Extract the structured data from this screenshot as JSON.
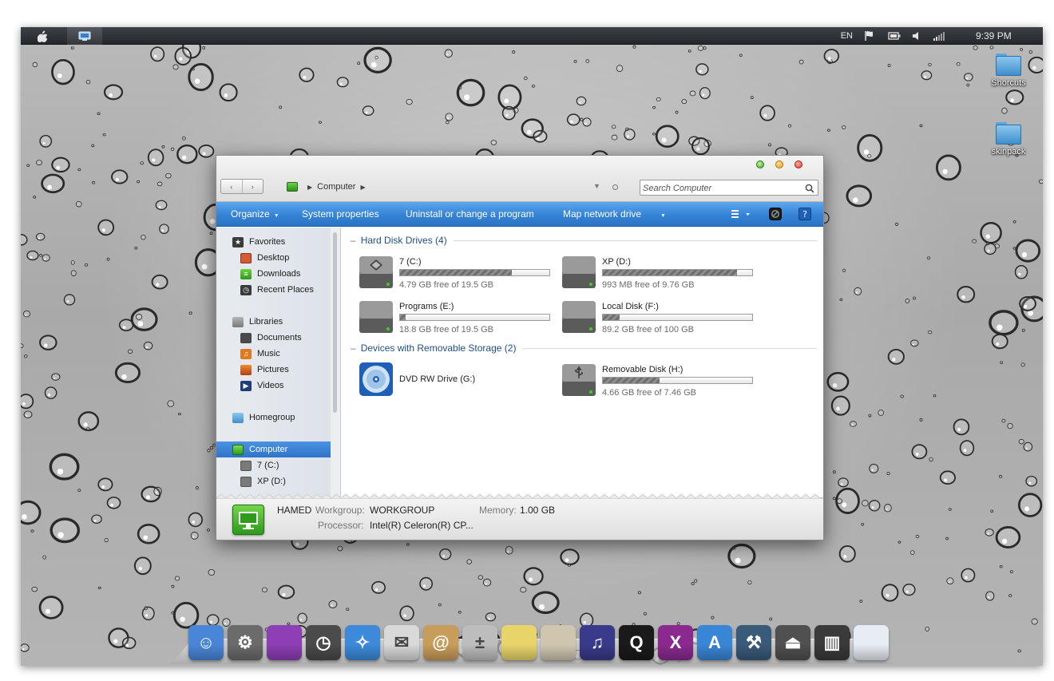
{
  "menubar": {
    "apple_icon": "apple-logo-icon",
    "computer_icon": "computer-menu-icon",
    "language": "EN",
    "time": "9:39 PM",
    "tray_icons": [
      "flag-icon",
      "battery-icon",
      "volume-icon",
      "signal-icon"
    ]
  },
  "desktop_icons": [
    {
      "label": "Shorcuts",
      "icon": "folder-icon"
    },
    {
      "label": "skinpack",
      "icon": "folder-icon"
    }
  ],
  "window": {
    "nav": {
      "back": "‹",
      "forward": "›"
    },
    "breadcrumb": [
      "Computer"
    ],
    "search": {
      "placeholder": "Search Computer"
    },
    "toolbar": [
      "Organize",
      "System properties",
      "Uninstall or change a program",
      "Map network drive"
    ],
    "nav_pane": {
      "favorites": {
        "label": "Favorites",
        "items": [
          "Desktop",
          "Downloads",
          "Recent Places"
        ]
      },
      "libraries": {
        "label": "Libraries",
        "items": [
          "Documents",
          "Music",
          "Pictures",
          "Videos"
        ]
      },
      "homegroup": "Homegroup",
      "computer": {
        "label": "Computer",
        "items": [
          "7 (C:)",
          "XP (D:)"
        ]
      }
    },
    "groups": {
      "hdd": {
        "label": "Hard Disk Drives (4)",
        "drives": [
          {
            "name": "7 (C:)",
            "free": "4.79 GB free of 19.5 GB",
            "used_fraction": 0.75
          },
          {
            "name": "XP (D:)",
            "free": "993 MB free of 9.76 GB",
            "used_fraction": 0.9
          },
          {
            "name": "Programs (E:)",
            "free": "18.8 GB free of 19.5 GB",
            "used_fraction": 0.04
          },
          {
            "name": "Local Disk (F:)",
            "free": "89.2 GB free of 100 GB",
            "used_fraction": 0.11
          }
        ]
      },
      "removable": {
        "label": "Devices with Removable Storage (2)",
        "drives": [
          {
            "name": "DVD RW Drive (G:)"
          },
          {
            "name": "Removable Disk (H:)",
            "free": "4.66 GB free of 7.46 GB",
            "used_fraction": 0.38
          }
        ]
      }
    },
    "details": {
      "name": "HAMED",
      "workgroup_label": "Workgroup:",
      "workgroup": "WORKGROUP",
      "memory_label": "Memory:",
      "memory": "1.00 GB",
      "processor_label": "Processor:",
      "processor": "Intel(R) Celeron(R) CP..."
    }
  },
  "dock": [
    {
      "name": "finder",
      "color": "#4a86d8"
    },
    {
      "name": "system-preferences",
      "color": "#6b6b6b"
    },
    {
      "name": "photo-booth",
      "color": "#8e3fb5"
    },
    {
      "name": "dashboard",
      "color": "#4b4b4b"
    },
    {
      "name": "safari",
      "color": "#3c8ad9"
    },
    {
      "name": "mail",
      "color": "#d9d9d9"
    },
    {
      "name": "address-book",
      "color": "#c89c5a"
    },
    {
      "name": "calculator",
      "color": "#bdbdbd"
    },
    {
      "name": "stickies",
      "color": "#e9d46a"
    },
    {
      "name": "textedit",
      "color": "#d0c6b0"
    },
    {
      "name": "itunes",
      "color": "#3a3a8a"
    },
    {
      "name": "quicktime",
      "color": "#1a1a1a"
    },
    {
      "name": "x-app",
      "color": "#8a2a8f"
    },
    {
      "name": "app-store",
      "color": "#3a86d6"
    },
    {
      "name": "xcode-tools",
      "color": "#3a5a7a"
    },
    {
      "name": "eject",
      "color": "#505050"
    },
    {
      "name": "trash",
      "color": "#3a3a3a"
    },
    {
      "name": "explorer-window",
      "color": "#e8edf3"
    }
  ]
}
